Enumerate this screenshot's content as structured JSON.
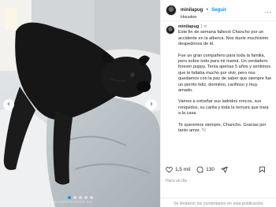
{
  "post": {
    "author": "minilapug",
    "separator": "•",
    "follow_label": "Seguir",
    "location": "Houston",
    "more_label": "...",
    "time_ago": "1 d",
    "caption_paragraphs": [
      "Este fin de semana falleció Chancho por un accidente en la alberca. Nos duele muchísimo despedirnos de él.",
      "Fue un gran compañero para toda la familia, pero sobre todo para mi mamá. Un verdadero forever puppy. Tenía apenas 5 años y sentimos que le faltaba mucho por vivir, pero nos quedamos con la paz de saber que siempre fue un perrito feliz, dormilón, cariñoso y muy amado.",
      "Vamos a extrañar sus ladridos roncos, sus ronquidos, su carita y toda la ternura que traía a la casa.",
      "Te queremos siempre, Chancho. Gracias por tanto amor. 🕊️"
    ],
    "likes": "1,5 mil",
    "comments": "130",
    "date": "Hace un día",
    "comments_disabled": "Se limitaron los comentarios en esta publicación."
  },
  "photo": {
    "watermark": "www.radioformula.mx",
    "dot_count": 5,
    "active_dot": 0,
    "prev_icon": "‹",
    "next_icon": "›"
  },
  "colors": {
    "accent": "#0095f6",
    "muted": "#8e8e8e",
    "text": "#262626"
  }
}
